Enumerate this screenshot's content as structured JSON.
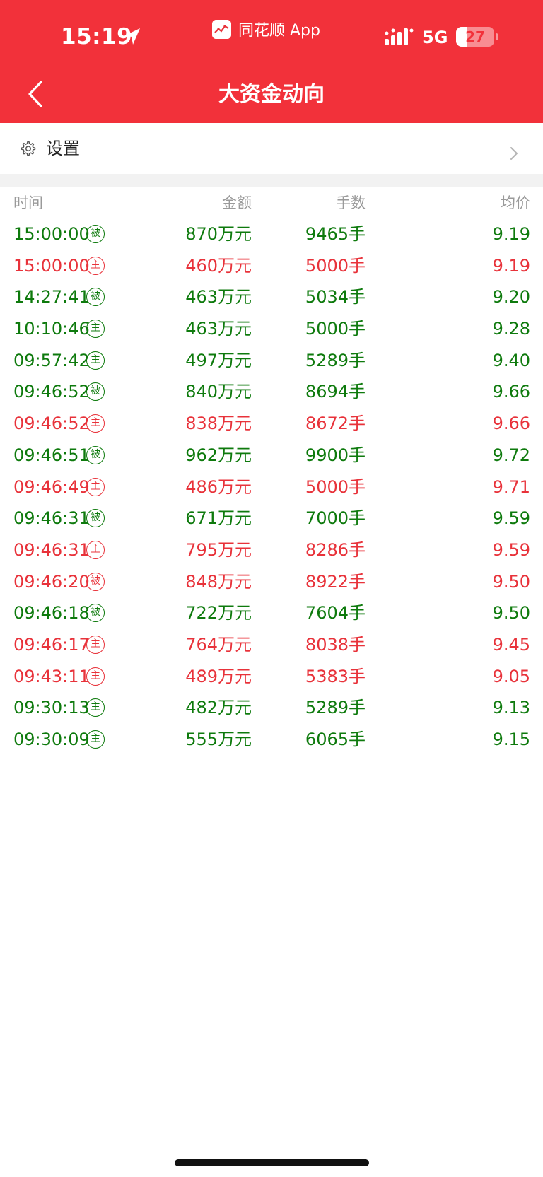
{
  "status_bar": {
    "time": "15:19",
    "app_name": "同花顺 App",
    "network": "5G",
    "battery": "27",
    "battery_level": 0.27
  },
  "nav": {
    "title": "大资金动向",
    "back_icon": "chevron-left-icon"
  },
  "settings": {
    "label": "设置",
    "icon": "gear-icon",
    "arrow_icon": "chevron-right-icon"
  },
  "colors": {
    "header_red": "#f2313a",
    "up_red": "#e8323a",
    "down_green": "#0e7a0d",
    "header_text_gray": "#9a9a9a"
  },
  "table": {
    "columns": [
      "时间",
      "金额",
      "手数",
      "均价"
    ],
    "rows": [
      {
        "time": "15:00:00",
        "tag": "被",
        "amount": "870万元",
        "volume": "9465手",
        "price": "9.19",
        "color": "green"
      },
      {
        "time": "15:00:00",
        "tag": "主",
        "amount": "460万元",
        "volume": "5000手",
        "price": "9.19",
        "color": "red"
      },
      {
        "time": "14:27:41",
        "tag": "被",
        "amount": "463万元",
        "volume": "5034手",
        "price": "9.20",
        "color": "green"
      },
      {
        "time": "10:10:46",
        "tag": "主",
        "amount": "463万元",
        "volume": "5000手",
        "price": "9.28",
        "color": "green"
      },
      {
        "time": "09:57:42",
        "tag": "主",
        "amount": "497万元",
        "volume": "5289手",
        "price": "9.40",
        "color": "green"
      },
      {
        "time": "09:46:52",
        "tag": "被",
        "amount": "840万元",
        "volume": "8694手",
        "price": "9.66",
        "color": "green"
      },
      {
        "time": "09:46:52",
        "tag": "主",
        "amount": "838万元",
        "volume": "8672手",
        "price": "9.66",
        "color": "red"
      },
      {
        "time": "09:46:51",
        "tag": "被",
        "amount": "962万元",
        "volume": "9900手",
        "price": "9.72",
        "color": "green"
      },
      {
        "time": "09:46:49",
        "tag": "主",
        "amount": "486万元",
        "volume": "5000手",
        "price": "9.71",
        "color": "red"
      },
      {
        "time": "09:46:31",
        "tag": "被",
        "amount": "671万元",
        "volume": "7000手",
        "price": "9.59",
        "color": "green"
      },
      {
        "time": "09:46:31",
        "tag": "主",
        "amount": "795万元",
        "volume": "8286手",
        "price": "9.59",
        "color": "red"
      },
      {
        "time": "09:46:20",
        "tag": "被",
        "amount": "848万元",
        "volume": "8922手",
        "price": "9.50",
        "color": "red"
      },
      {
        "time": "09:46:18",
        "tag": "被",
        "amount": "722万元",
        "volume": "7604手",
        "price": "9.50",
        "color": "green"
      },
      {
        "time": "09:46:17",
        "tag": "主",
        "amount": "764万元",
        "volume": "8038手",
        "price": "9.45",
        "color": "red"
      },
      {
        "time": "09:43:11",
        "tag": "主",
        "amount": "489万元",
        "volume": "5383手",
        "price": "9.05",
        "color": "red"
      },
      {
        "time": "09:30:13",
        "tag": "主",
        "amount": "482万元",
        "volume": "5289手",
        "price": "9.13",
        "color": "green"
      },
      {
        "time": "09:30:09",
        "tag": "主",
        "amount": "555万元",
        "volume": "6065手",
        "price": "9.15",
        "color": "green"
      }
    ]
  }
}
